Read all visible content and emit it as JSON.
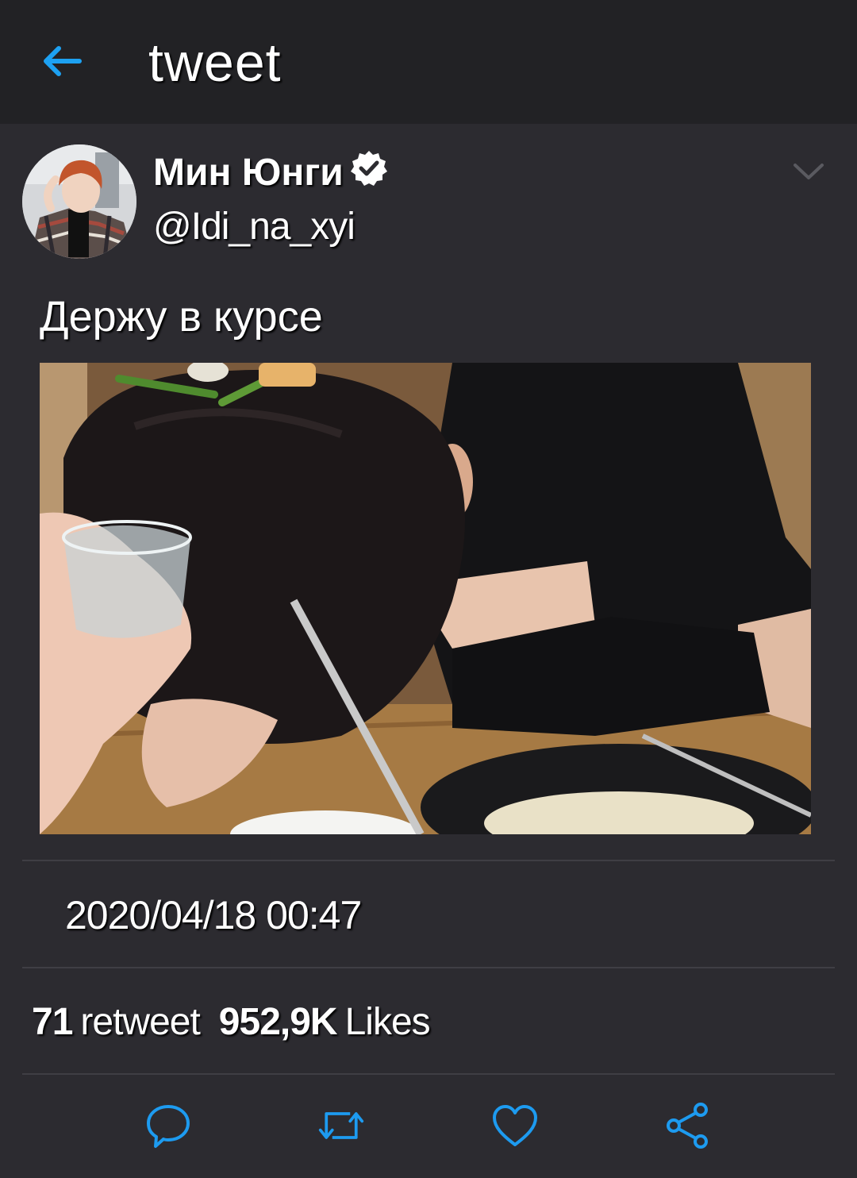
{
  "header": {
    "title": "tweet",
    "back_icon": "arrow-left-icon",
    "accent_color": "#1da1f2"
  },
  "author": {
    "display_name": "Мин Юнги",
    "handle": "@Idi_na_xyi",
    "verified": true,
    "avatar_icon": "avatar"
  },
  "tweet": {
    "text": "Держу в курсе",
    "timestamp": "2020/04/18 00:47"
  },
  "stats": {
    "retweets_count": "71",
    "retweets_label": "retweet",
    "likes_count": "952,9K",
    "likes_label": "Likes"
  },
  "actions": {
    "reply_icon": "reply-icon",
    "retweet_icon": "retweet-icon",
    "like_icon": "heart-icon",
    "share_icon": "share-icon",
    "icon_color": "#1d9bf0"
  }
}
